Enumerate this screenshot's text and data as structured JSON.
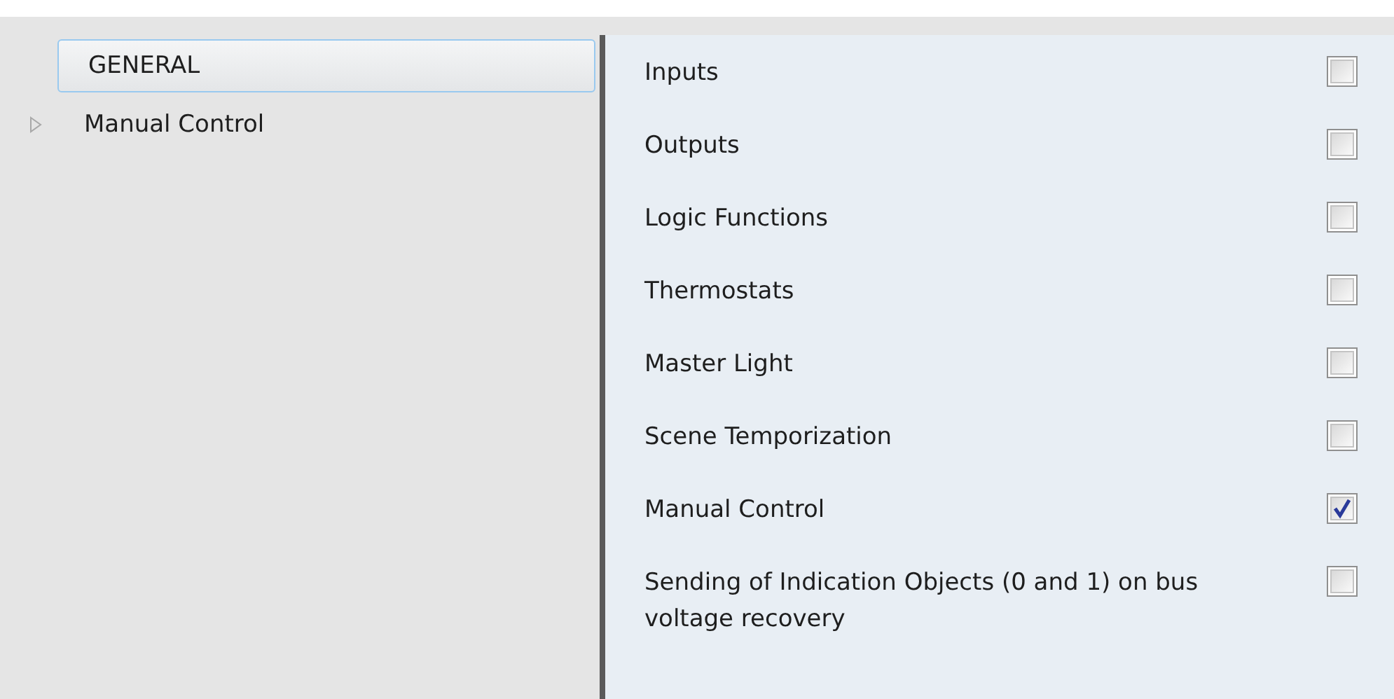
{
  "tree": {
    "items": [
      {
        "label": "GENERAL",
        "selected": true,
        "has_children": false
      },
      {
        "label": "Manual Control",
        "selected": false,
        "has_children": true
      }
    ]
  },
  "options": [
    {
      "label": "Inputs",
      "checked": false
    },
    {
      "label": "Outputs",
      "checked": false
    },
    {
      "label": "Logic Functions",
      "checked": false
    },
    {
      "label": "Thermostats",
      "checked": false
    },
    {
      "label": "Master Light",
      "checked": false
    },
    {
      "label": "Scene Temporization",
      "checked": false
    },
    {
      "label": "Manual Control",
      "checked": true
    },
    {
      "label": "Sending of Indication Objects (0 and 1) on bus voltage recovery",
      "checked": false
    }
  ]
}
